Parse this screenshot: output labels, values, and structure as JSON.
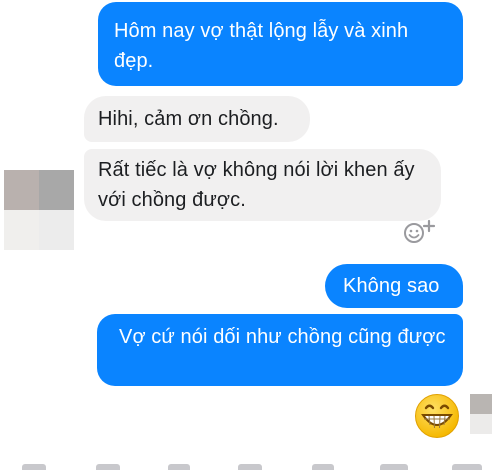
{
  "conversation": {
    "messages": [
      {
        "sender": "me",
        "text": "Hôm nay vợ thật lộng lẫy và xinh đẹp."
      },
      {
        "sender": "partner",
        "text": "Hihi, cảm ơn chồng."
      },
      {
        "sender": "partner",
        "text": "Rất tiếc là vợ không nói lời khen ấy với chồng được."
      },
      {
        "sender": "me",
        "text": "Không sao"
      },
      {
        "sender": "me",
        "text": "Vợ cứ nói dối như chồng cũng được"
      }
    ]
  },
  "reaction": {
    "icon": "add-reaction-icon"
  },
  "sent_emoji": {
    "icon": "grinning-face-emoji"
  },
  "partner_avatar": {
    "icon": "blurred-avatar"
  },
  "colors": {
    "outgoing_bubble": "#0a84ff",
    "incoming_bubble": "#f1f0f0",
    "outgoing_text": "#ffffff",
    "incoming_text": "#1c1e21"
  }
}
